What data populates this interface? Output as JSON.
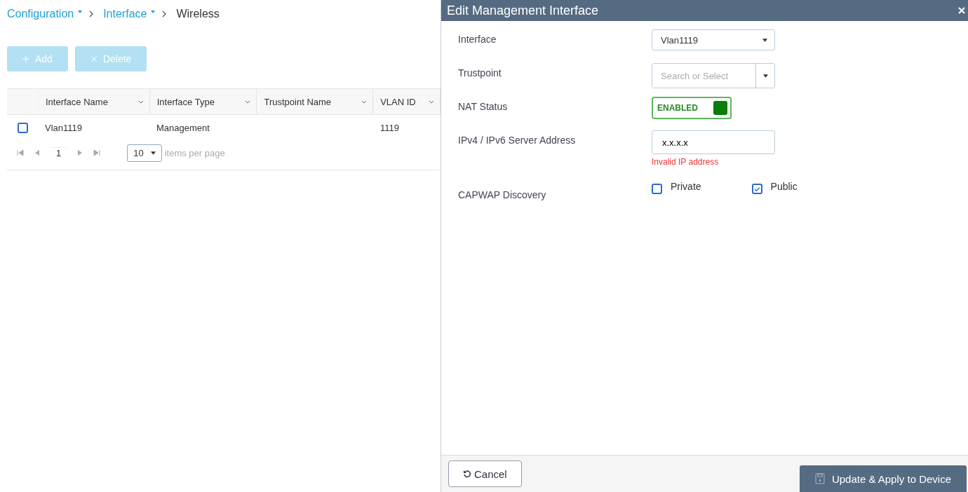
{
  "breadcrumb": [
    {
      "label": "Configuration",
      "kind": "menu"
    },
    {
      "label": "Interface",
      "kind": "menu"
    },
    {
      "label": "Wireless",
      "kind": "current"
    }
  ],
  "toolbar": [
    {
      "label": "Add",
      "kind": "add",
      "disabled": true
    },
    {
      "label": "Delete",
      "kind": "delete",
      "disabled": true
    }
  ],
  "table": {
    "columns": [
      "Interface Name",
      "Interface Type",
      "Trustpoint Name",
      "VLAN ID"
    ],
    "rows": [
      {
        "checked": false,
        "interface_name": "Vlan1119",
        "interface_type": "Management",
        "vlan_id": "1119"
      }
    ]
  },
  "pager": {
    "page": "1",
    "per_page": "10",
    "per_page_label": "items per page"
  },
  "panel": {
    "title": "Edit Management Interface",
    "fields": [
      {
        "kind": "select",
        "label": "Interface",
        "value": "Vlan1119"
      },
      {
        "kind": "combo",
        "label": "Trustpoint",
        "placeholder": "Search or Select"
      },
      {
        "kind": "toggle",
        "label": "NAT Status",
        "on": true,
        "text": "ENABLED"
      },
      {
        "kind": "text",
        "label": "IPv4 / IPv6 Server Address",
        "value": "x.x.x.x",
        "error": "Invalid IP address"
      },
      {
        "kind": "checkboxes",
        "label": "CAPWAP Discovery",
        "options": [
          {
            "label": "Private",
            "checked": false
          },
          {
            "label": "Public",
            "checked": true
          }
        ]
      }
    ],
    "cancel": "Cancel",
    "apply": "Update & Apply to Device"
  }
}
